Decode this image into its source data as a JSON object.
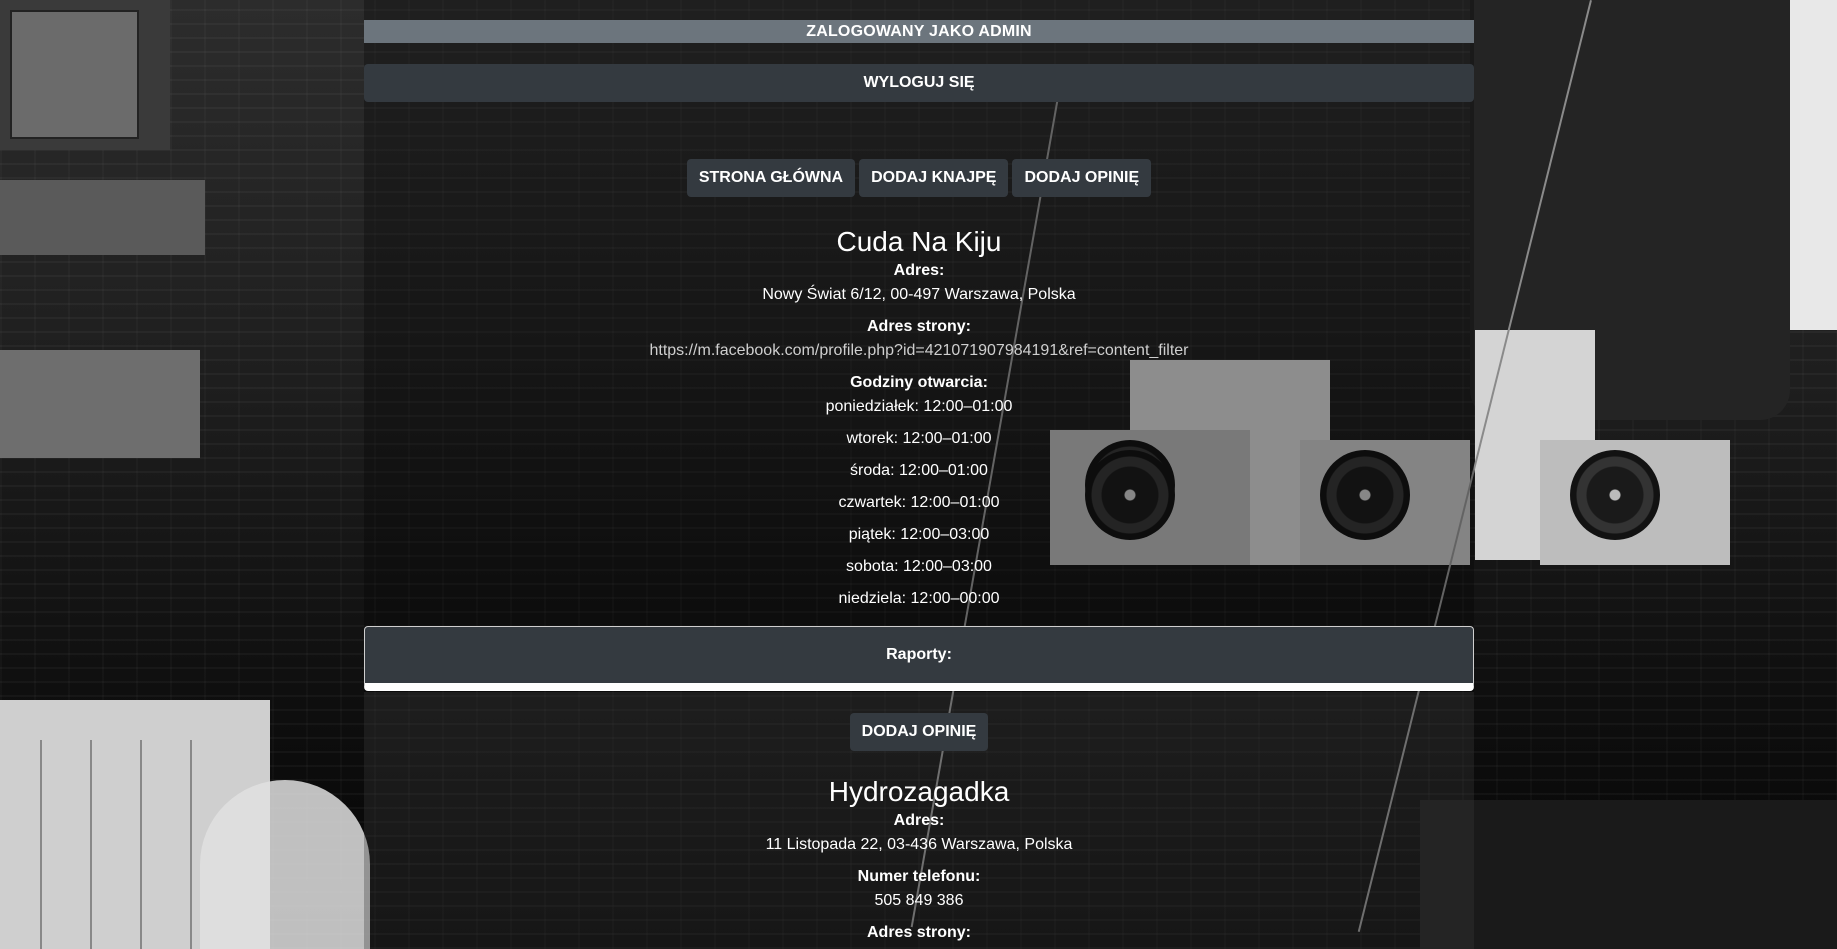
{
  "header": {
    "login_status": "ZALOGOWANY JAKO ADMIN",
    "logout_label": "WYLOGUJ SIĘ"
  },
  "nav": [
    {
      "label": "STRONA GŁÓWNA"
    },
    {
      "label": "DODAJ KNAJPĘ"
    },
    {
      "label": "DODAJ OPINIĘ"
    }
  ],
  "restaurants": [
    {
      "name": "Cuda Na Kiju",
      "address_label": "Adres:",
      "address": "Nowy Świat 6/12, 00-497 Warszawa, Polska",
      "website_label": "Adres strony:",
      "website": "https://m.facebook.com/profile.php?id=421071907984191&ref=content_filter",
      "hours_label": "Godziny otwarcia:",
      "hours": [
        "poniedziałek: 12:00–01:00",
        "wtorek: 12:00–01:00",
        "środa: 12:00–01:00",
        "czwartek: 12:00–01:00",
        "piątek: 12:00–03:00",
        "sobota: 12:00–03:00",
        "niedziela: 12:00–00:00"
      ],
      "reports_label": "Raporty:",
      "add_review_label": "DODAJ OPINIĘ"
    },
    {
      "name": "Hydrozagadka",
      "address_label": "Adres:",
      "address": "11 Listopada 22, 03-436 Warszawa, Polska",
      "phone_label": "Numer telefonu:",
      "phone": "505 849 386",
      "website_label": "Adres strony:"
    }
  ]
}
